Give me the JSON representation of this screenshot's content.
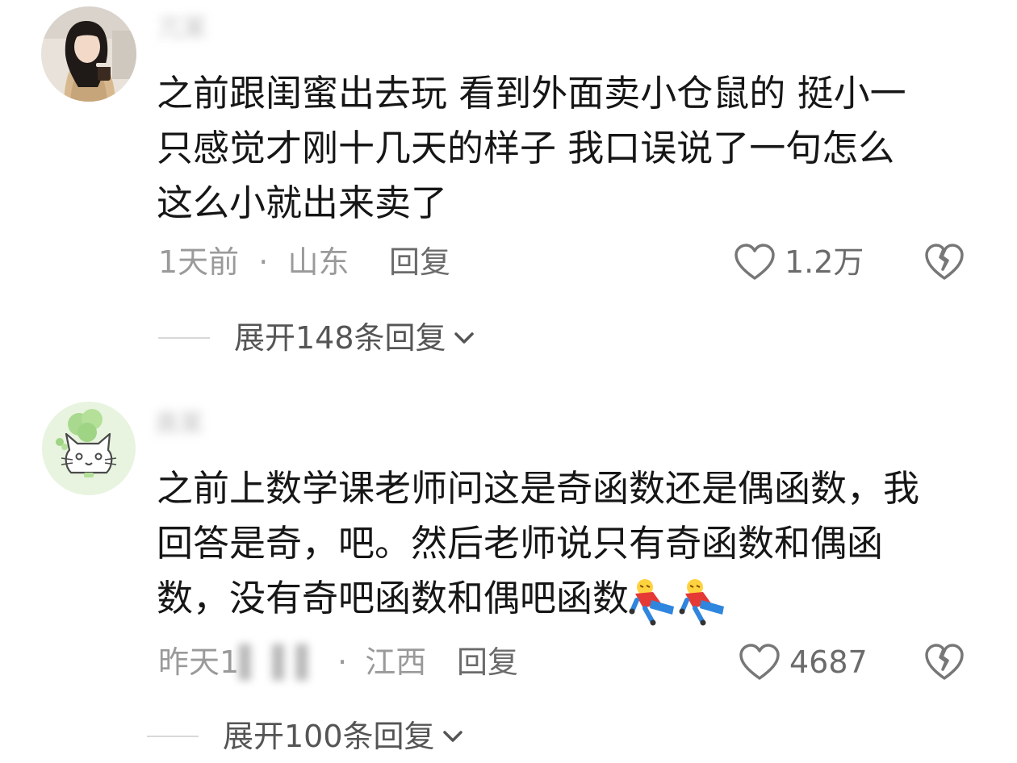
{
  "comments": [
    {
      "username": "兀某",
      "body_lines": [
        "之前跟闺蜜出去玩 看到外面卖小仓鼠的 挺小一",
        "只感觉才刚十几天的样子 我口误说了一句怎么",
        "这么小就出来卖了"
      ],
      "time": "1天前",
      "separator": "·",
      "location": "山东",
      "reply_label": "回复",
      "likes": "1.2万",
      "expand_label": "展开148条回复"
    },
    {
      "username": "奥某",
      "body_lines": [
        "之前上数学课老师问这是奇函数还是偶函数，我",
        "回答是奇，吧。然后老师说只有奇函数和偶函",
        "数，没有奇吧函数和偶吧函数"
      ],
      "time_prefix": "昨天1",
      "time_hidden": "▌ ▌▌",
      "separator": "·",
      "location": "江西",
      "reply_label": "回复",
      "likes": "4687",
      "expand_label": "展开100条回复"
    }
  ],
  "icons": {
    "like": "heart-outline-icon",
    "dislike": "broken-heart-icon",
    "expand": "chevron-down-icon",
    "emoji": "fallen-over-emoji-icon"
  },
  "colors": {
    "text": "#161616",
    "meta": "#9a9a9a",
    "secondary": "#6b6b6b",
    "divider": "#d8d8d8",
    "background": "#ffffff"
  }
}
